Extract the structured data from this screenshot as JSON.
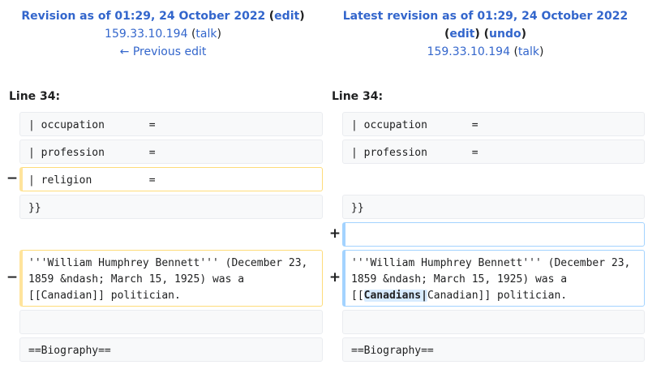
{
  "left_header": {
    "title": "Revision as of 01:29, 24 October 2022",
    "edit": "edit",
    "user": "159.33.10.194",
    "talk": "talk",
    "prev": "← Previous edit"
  },
  "right_header": {
    "title": "Latest revision as of 01:29, 24 October 2022",
    "edit": "edit",
    "undo": "undo",
    "user": "159.33.10.194",
    "talk": "talk"
  },
  "line_left": "Line 34:",
  "line_right": "Line 34:",
  "markers": {
    "minus": "−",
    "plus": "+"
  },
  "rows": {
    "occupation": "| occupation       =",
    "profession": "| profession       =",
    "religion": "| religion         =",
    "close": "}}",
    "biography": "==Biography=="
  },
  "paragraph_left": {
    "line1": "'''William Humphrey Bennett''' (December 23,",
    "line2": "1859 &ndash; March 15, 1925) was a",
    "line3": "[[Canadian]] politician."
  },
  "paragraph_right": {
    "line1": "'''William Humphrey Bennett''' (December 23,",
    "line2": "1859 &ndash; March 15, 1925) was a",
    "line3_pre": "[[",
    "line3_hl": "Canadians|",
    "line3_post": "Canadian]] politician."
  }
}
